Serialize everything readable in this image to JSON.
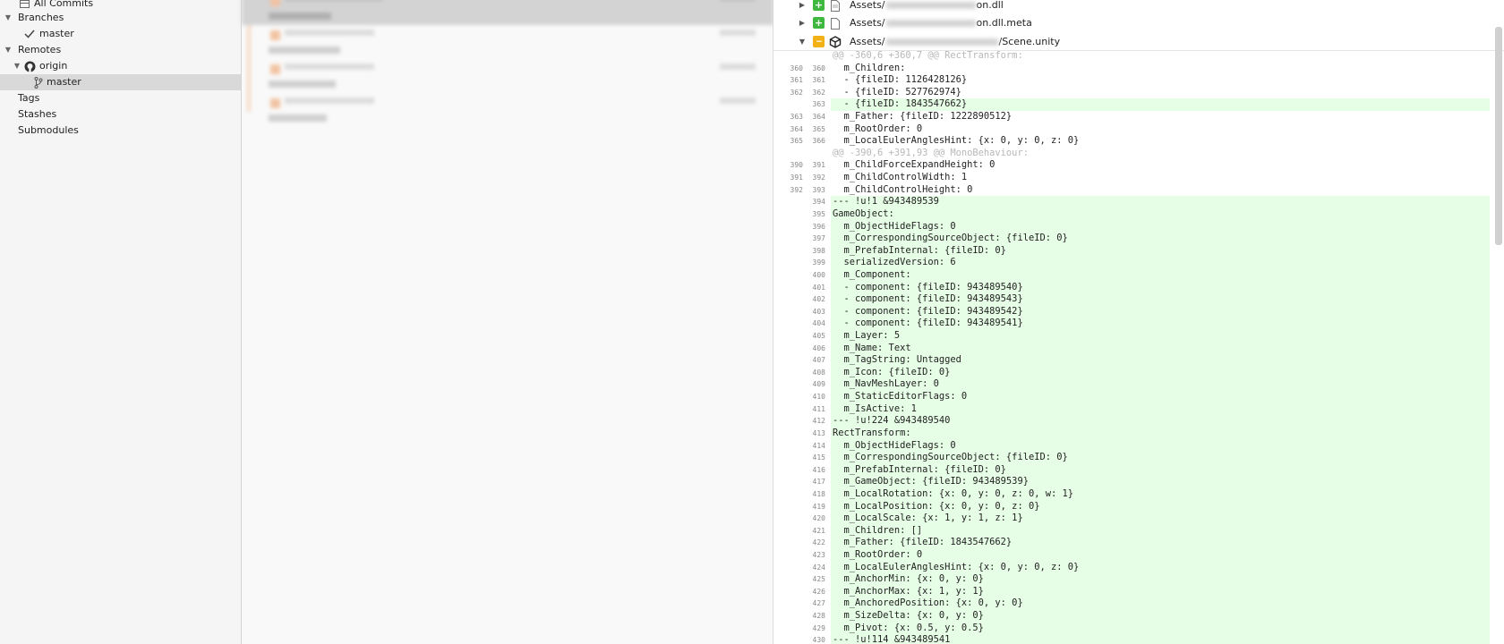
{
  "sidebar": {
    "all_commits": "All Commits",
    "branches": "Branches",
    "branch_master": "master",
    "remotes": "Remotes",
    "origin": "origin",
    "origin_master": "master",
    "tags": "Tags",
    "stashes": "Stashes",
    "submodules": "Submodules"
  },
  "files": [
    {
      "prefix": "Assets/",
      "suffix": "on.dll",
      "status": "added",
      "badge": "+",
      "badge_color": "#3eb83e",
      "icon": "file-icon"
    },
    {
      "prefix": "Assets/",
      "suffix": "on.dll.meta",
      "status": "added",
      "badge": "+",
      "badge_color": "#3eb83e",
      "icon": "file-icon"
    },
    {
      "prefix": "Assets/",
      "suffix": "/Scene.unity",
      "status": "modified",
      "badge": "···",
      "badge_color": "#f3b118",
      "icon": "unity-icon"
    }
  ],
  "diff": [
    {
      "t": "hunk",
      "o": "",
      "n": "",
      "c": "@@ -360,6 +360,7 @@ RectTransform:"
    },
    {
      "t": "ctx",
      "o": "360",
      "n": "360",
      "c": "  m_Children:"
    },
    {
      "t": "ctx",
      "o": "361",
      "n": "361",
      "c": "  - {fileID: 1126428126}"
    },
    {
      "t": "ctx",
      "o": "362",
      "n": "362",
      "c": "  - {fileID: 527762974}"
    },
    {
      "t": "add",
      "o": "",
      "n": "363",
      "c": "  - {fileID: 1843547662}"
    },
    {
      "t": "ctx",
      "o": "363",
      "n": "364",
      "c": "  m_Father: {fileID: 1222890512}"
    },
    {
      "t": "ctx",
      "o": "364",
      "n": "365",
      "c": "  m_RootOrder: 0"
    },
    {
      "t": "ctx",
      "o": "365",
      "n": "366",
      "c": "  m_LocalEulerAnglesHint: {x: 0, y: 0, z: 0}"
    },
    {
      "t": "hunk",
      "o": "",
      "n": "",
      "c": "@@ -390,6 +391,93 @@ MonoBehaviour:"
    },
    {
      "t": "ctx",
      "o": "390",
      "n": "391",
      "c": "  m_ChildForceExpandHeight: 0"
    },
    {
      "t": "ctx",
      "o": "391",
      "n": "392",
      "c": "  m_ChildControlWidth: 1"
    },
    {
      "t": "ctx",
      "o": "392",
      "n": "393",
      "c": "  m_ChildControlHeight: 0"
    },
    {
      "t": "add",
      "o": "",
      "n": "394",
      "c": "--- !u!1 &943489539"
    },
    {
      "t": "add",
      "o": "",
      "n": "395",
      "c": "GameObject:"
    },
    {
      "t": "add",
      "o": "",
      "n": "396",
      "c": "  m_ObjectHideFlags: 0"
    },
    {
      "t": "add",
      "o": "",
      "n": "397",
      "c": "  m_CorrespondingSourceObject: {fileID: 0}"
    },
    {
      "t": "add",
      "o": "",
      "n": "398",
      "c": "  m_PrefabInternal: {fileID: 0}"
    },
    {
      "t": "add",
      "o": "",
      "n": "399",
      "c": "  serializedVersion: 6"
    },
    {
      "t": "add",
      "o": "",
      "n": "400",
      "c": "  m_Component:"
    },
    {
      "t": "add",
      "o": "",
      "n": "401",
      "c": "  - component: {fileID: 943489540}"
    },
    {
      "t": "add",
      "o": "",
      "n": "402",
      "c": "  - component: {fileID: 943489543}"
    },
    {
      "t": "add",
      "o": "",
      "n": "403",
      "c": "  - component: {fileID: 943489542}"
    },
    {
      "t": "add",
      "o": "",
      "n": "404",
      "c": "  - component: {fileID: 943489541}"
    },
    {
      "t": "add",
      "o": "",
      "n": "405",
      "c": "  m_Layer: 5"
    },
    {
      "t": "add",
      "o": "",
      "n": "406",
      "c": "  m_Name: Text"
    },
    {
      "t": "add",
      "o": "",
      "n": "407",
      "c": "  m_TagString: Untagged"
    },
    {
      "t": "add",
      "o": "",
      "n": "408",
      "c": "  m_Icon: {fileID: 0}"
    },
    {
      "t": "add",
      "o": "",
      "n": "409",
      "c": "  m_NavMeshLayer: 0"
    },
    {
      "t": "add",
      "o": "",
      "n": "410",
      "c": "  m_StaticEditorFlags: 0"
    },
    {
      "t": "add",
      "o": "",
      "n": "411",
      "c": "  m_IsActive: 1"
    },
    {
      "t": "add",
      "o": "",
      "n": "412",
      "c": "--- !u!224 &943489540"
    },
    {
      "t": "add",
      "o": "",
      "n": "413",
      "c": "RectTransform:"
    },
    {
      "t": "add",
      "o": "",
      "n": "414",
      "c": "  m_ObjectHideFlags: 0"
    },
    {
      "t": "add",
      "o": "",
      "n": "415",
      "c": "  m_CorrespondingSourceObject: {fileID: 0}"
    },
    {
      "t": "add",
      "o": "",
      "n": "416",
      "c": "  m_PrefabInternal: {fileID: 0}"
    },
    {
      "t": "add",
      "o": "",
      "n": "417",
      "c": "  m_GameObject: {fileID: 943489539}"
    },
    {
      "t": "add",
      "o": "",
      "n": "418",
      "c": "  m_LocalRotation: {x: 0, y: 0, z: 0, w: 1}"
    },
    {
      "t": "add",
      "o": "",
      "n": "419",
      "c": "  m_LocalPosition: {x: 0, y: 0, z: 0}"
    },
    {
      "t": "add",
      "o": "",
      "n": "420",
      "c": "  m_LocalScale: {x: 1, y: 1, z: 1}"
    },
    {
      "t": "add",
      "o": "",
      "n": "421",
      "c": "  m_Children: []"
    },
    {
      "t": "add",
      "o": "",
      "n": "422",
      "c": "  m_Father: {fileID: 1843547662}"
    },
    {
      "t": "add",
      "o": "",
      "n": "423",
      "c": "  m_RootOrder: 0"
    },
    {
      "t": "add",
      "o": "",
      "n": "424",
      "c": "  m_LocalEulerAnglesHint: {x: 0, y: 0, z: 0}"
    },
    {
      "t": "add",
      "o": "",
      "n": "425",
      "c": "  m_AnchorMin: {x: 0, y: 0}"
    },
    {
      "t": "add",
      "o": "",
      "n": "426",
      "c": "  m_AnchorMax: {x: 1, y: 1}"
    },
    {
      "t": "add",
      "o": "",
      "n": "427",
      "c": "  m_AnchoredPosition: {x: 0, y: 0}"
    },
    {
      "t": "add",
      "o": "",
      "n": "428",
      "c": "  m_SizeDelta: {x: 0, y: 0}"
    },
    {
      "t": "add",
      "o": "",
      "n": "429",
      "c": "  m_Pivot: {x: 0.5, y: 0.5}"
    },
    {
      "t": "add",
      "o": "",
      "n": "430",
      "c": "--- !u!114 &943489541"
    }
  ],
  "colors": {
    "added_bg": "#e6fde6",
    "selected_bg": "#d9d9d9",
    "hunk_text": "#b8b8b8"
  }
}
